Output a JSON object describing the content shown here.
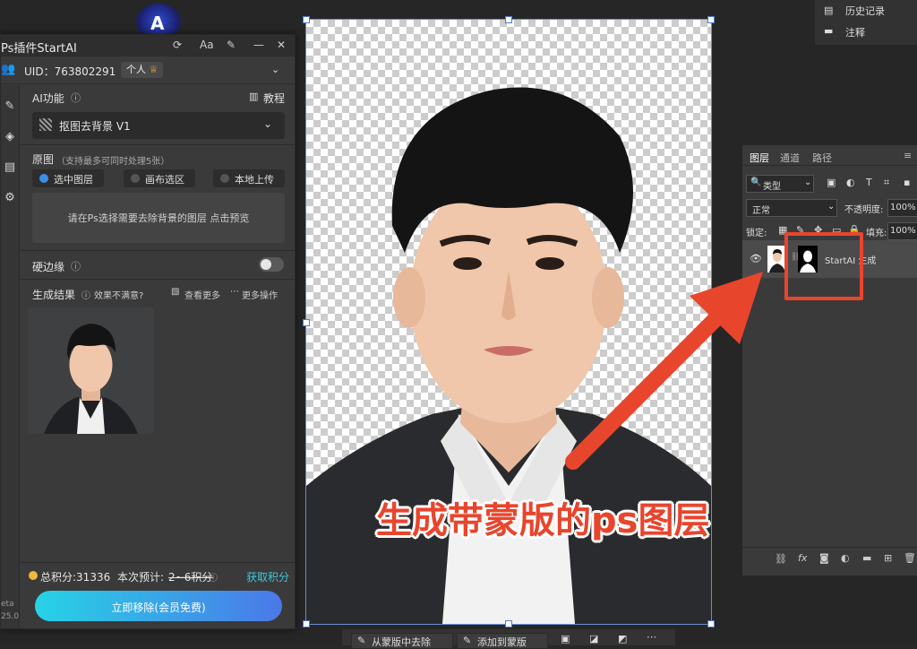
{
  "plugin": {
    "title": "Ps插件StartAI",
    "title_icons": [
      "refresh-icon",
      "font-size-icon",
      "pin-icon",
      "minimize-icon",
      "close-icon"
    ],
    "font_label": "Aa",
    "uid_label": "UID：763802291",
    "plan_badge": "个人",
    "ai_function_label": "AI功能",
    "tutorial_label": "教程",
    "function_selected": "抠图去背景 V1",
    "source_label": "原图",
    "source_hint": "（支持最多可同时处理5张）",
    "source_options": [
      "选中图层",
      "画布选区",
      "本地上传"
    ],
    "source_selected_index": 0,
    "dropzone_text": "请在Ps选择需要去除背景的图层 点击预览",
    "hard_edge_label": "硬边缘",
    "hard_edge_on": false,
    "result_label": "生成结果",
    "feedback_label": "效果不满意?",
    "view_more_label": "查看更多",
    "more_actions_label": "更多操作",
    "points_total": "总积分:31336",
    "points_estimate_label": "本次预计:",
    "points_estimate_value": "2~6积分",
    "get_points_label": "获取积分",
    "run_button": "立即移除(会员免费)",
    "side_label_1": "eta",
    "side_label_2": "25.0"
  },
  "right_panel": {
    "history_label": "历史记录",
    "notes_label": "注释"
  },
  "layers": {
    "tabs": [
      "图层",
      "通道",
      "路径"
    ],
    "filter_label": "类型",
    "blend_mode": "正常",
    "opacity_label": "不透明度:",
    "opacity_value": "100%",
    "lock_label": "锁定:",
    "fill_label": "填充:",
    "fill_value": "100%",
    "layer_name": "StartAI 生成"
  },
  "bottom_bar": {
    "remove_from_mask": "从蒙版中去除",
    "add_to_mask": "添加到蒙版"
  },
  "annotation": {
    "text": "生成带蒙版的ps图层"
  },
  "colors": {
    "annotation": "#e8452d",
    "accent_blue": "#3a90e8",
    "button_gradient_start": "#27d3e6",
    "button_gradient_end": "#4b78e8",
    "points_link": "#3cc8e0"
  }
}
